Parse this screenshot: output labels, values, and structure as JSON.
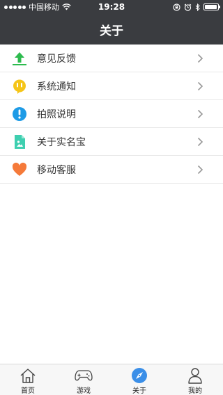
{
  "status_bar": {
    "carrier": "中国移动",
    "time": "19:28"
  },
  "nav": {
    "title": "关于"
  },
  "menu": {
    "items": [
      {
        "label": "意见反馈",
        "icon": "upload-arrow-icon",
        "color": "#2dbb4e"
      },
      {
        "label": "系统通知",
        "icon": "notification-bubble-icon",
        "color": "#f5c518"
      },
      {
        "label": "拍照说明",
        "icon": "info-exclamation-icon",
        "color": "#1e9be6"
      },
      {
        "label": "关于实名宝",
        "icon": "document-icon",
        "color": "#3ecfb0"
      },
      {
        "label": "移动客服",
        "icon": "heart-icon",
        "color": "#f57a3a"
      }
    ]
  },
  "tabbar": {
    "tabs": [
      {
        "label": "首页",
        "icon": "home-icon"
      },
      {
        "label": "游戏",
        "icon": "gamepad-icon"
      },
      {
        "label": "关于",
        "icon": "compass-icon",
        "active": true,
        "color": "#3b8fe8"
      },
      {
        "label": "我的",
        "icon": "person-icon"
      }
    ]
  }
}
